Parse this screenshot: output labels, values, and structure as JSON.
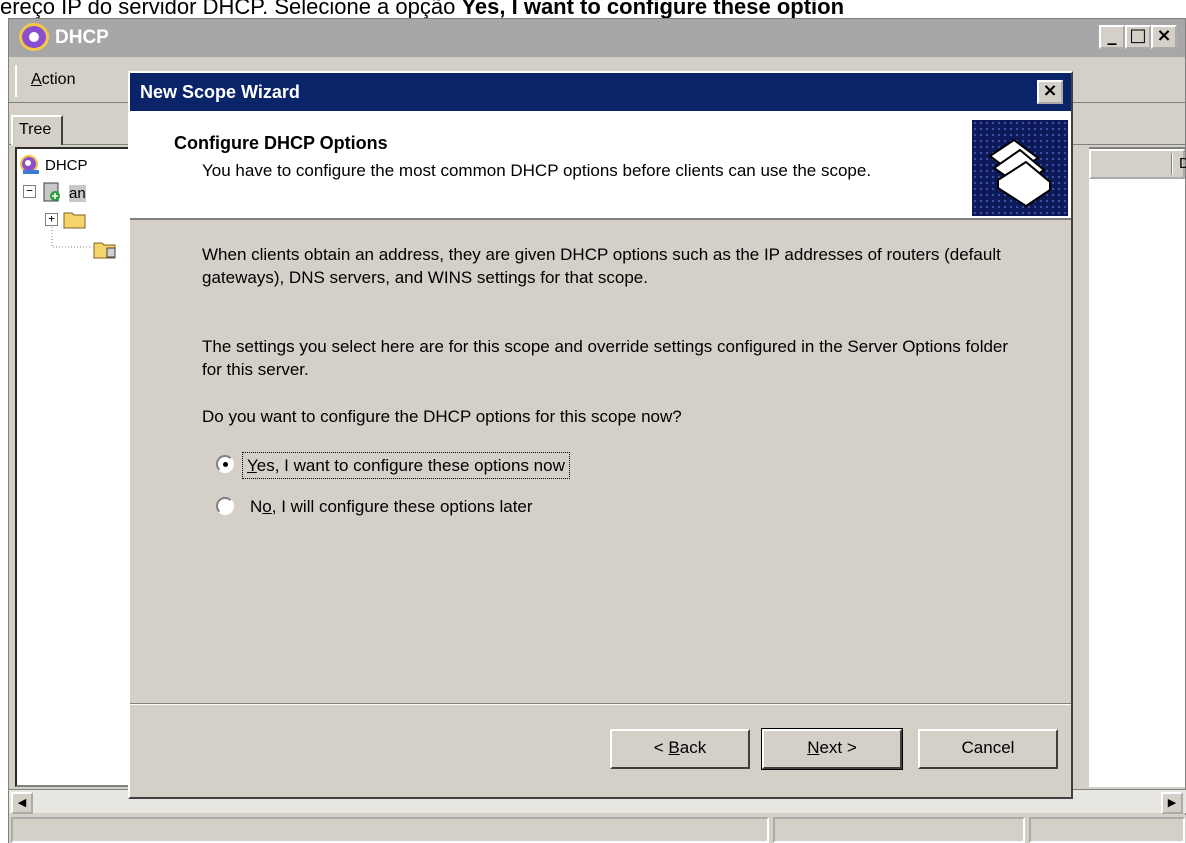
{
  "caption": {
    "prefix": "ereço IP do servidor DHCP. Selecione a opção ",
    "bold": "Yes, I want to configure these option"
  },
  "mmc": {
    "title": "DHCP",
    "menu_action_pre": "",
    "menu_action_u": "A",
    "menu_action_post": "ction",
    "tab_tree": "Tree",
    "tree_root": "DHCP",
    "tree_server": "an",
    "column_header": "D"
  },
  "wizard": {
    "title": "New Scope Wizard",
    "header_title": "Configure DHCP Options",
    "header_subtitle": "You have to configure the most common DHCP options before clients can use the scope.",
    "para1": "When clients obtain an address, they are given DHCP options such as the IP addresses of routers (default gateways), DNS servers, and WINS settings for that scope.",
    "para2": "The settings you select here are for this scope and override settings configured in the Server Options folder for this server.",
    "question": "Do you want to configure the DHCP options for this scope now?",
    "option_yes_u": "Y",
    "option_yes_rest": "es, I want to configure these options now",
    "option_no_pre": "N",
    "option_no_u": "o",
    "option_no_rest": ", I will configure these options later",
    "selected_option": "yes",
    "back_pre": "< ",
    "back_u": "B",
    "back_rest": "ack",
    "next_u": "N",
    "next_rest": "ext >",
    "cancel": "Cancel"
  },
  "colors": {
    "title_bar": "#0a246a",
    "face": "#d4d0c8"
  }
}
